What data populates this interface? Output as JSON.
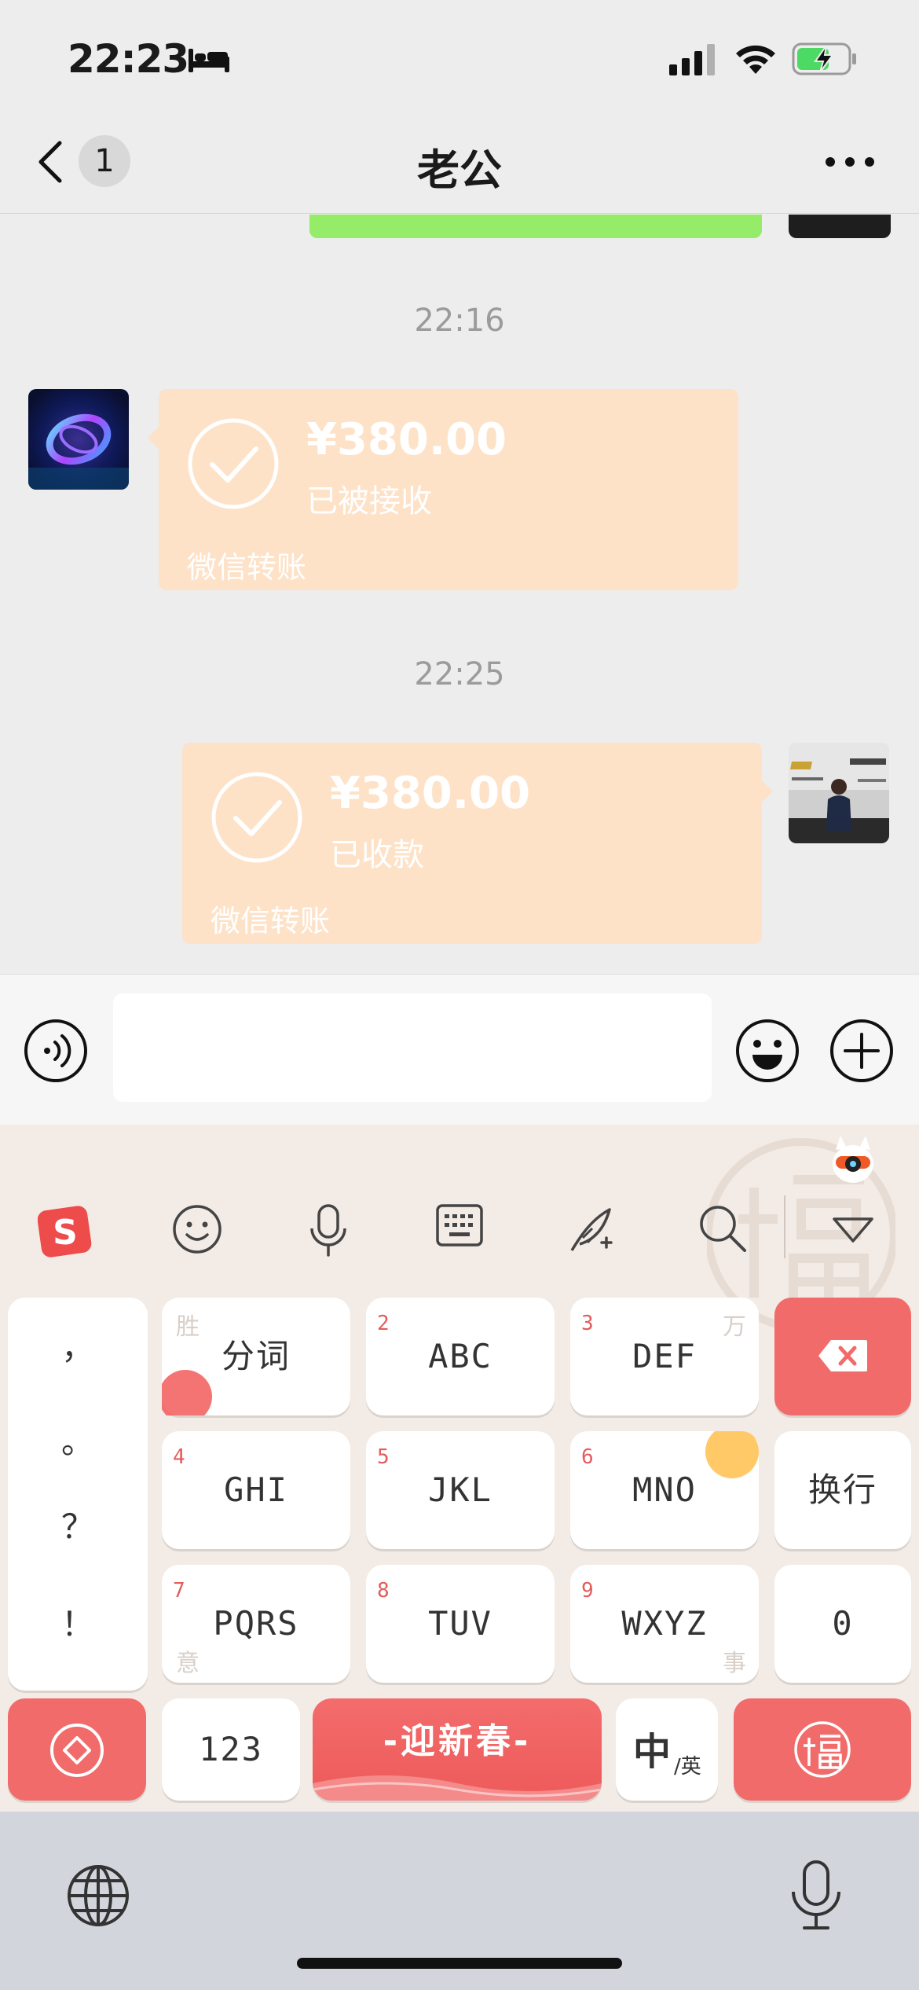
{
  "status_bar": {
    "time": "22:23",
    "icons": [
      "bed-icon",
      "signal-icon",
      "wifi-icon",
      "battery-charging-icon"
    ]
  },
  "nav": {
    "unread_count": "1",
    "title": "老公",
    "icons": [
      "back-icon",
      "more-icon"
    ]
  },
  "chat": {
    "messages": [
      {
        "timestamp": "22:16",
        "side": "left",
        "amount": "¥380.00",
        "status": "已被接收",
        "footer": "微信转账"
      },
      {
        "timestamp": "22:25",
        "side": "right",
        "amount": "¥380.00",
        "status": "已收款",
        "footer": "微信转账"
      }
    ]
  },
  "input_bar": {
    "placeholder": "",
    "icons": [
      "voice-icon",
      "emoji-icon",
      "plus-icon"
    ]
  },
  "keyboard": {
    "toolbar_icons": [
      "sogou-logo-icon",
      "emoji-icon",
      "microphone-icon",
      "keyboard-icon",
      "handwriting-icon",
      "search-icon",
      "collapse-icon"
    ],
    "punctuation": [
      "，",
      "。",
      "？",
      "！"
    ],
    "rows": [
      [
        {
          "num": "",
          "label": "分词"
        },
        {
          "num": "2",
          "label": "ABC"
        },
        {
          "num": "3",
          "label": "DEF"
        }
      ],
      [
        {
          "num": "4",
          "label": "GHI"
        },
        {
          "num": "5",
          "label": "JKL"
        },
        {
          "num": "6",
          "label": "MNO"
        }
      ],
      [
        {
          "num": "7",
          "label": "PQRS"
        },
        {
          "num": "8",
          "label": "TUV"
        },
        {
          "num": "9",
          "label": "WXYZ"
        }
      ]
    ],
    "corner_chars": {
      "top_left": "胜",
      "top_right": "万",
      "bottom_left": "意",
      "bottom_right": "事"
    },
    "right_keys": {
      "newline": "换行",
      "zero": "0"
    },
    "bottom_row": {
      "numbers": "123",
      "festive": "-迎新春-",
      "lang_main": "中",
      "lang_sub": "/英"
    },
    "accent_color": "#f26b6b"
  },
  "system_bar": {
    "icons": [
      "globe-icon",
      "dictation-icon"
    ]
  }
}
